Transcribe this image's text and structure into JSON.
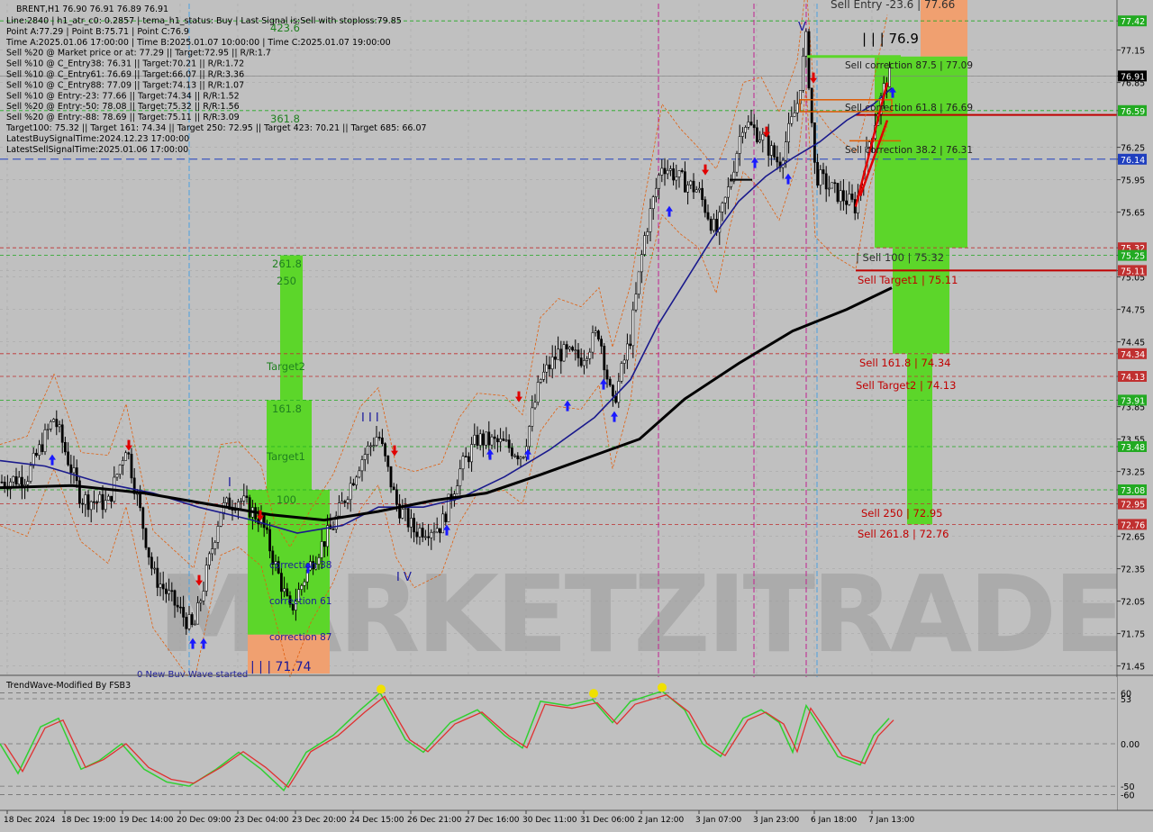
{
  "header": {
    "symbol_line": "BRENT,H1  76.90 76.91 76.89 76.91",
    "info_lines": [
      "Line:2840  |  h1_atr_c0: 0.2857  |  tema_h1_status: Buy  |  Last Signal is:Sell with stoploss:79.85",
      "Point A:77.29 | Point B:75.71 | Point C:76.9",
      "Time A:2025.01.06 17:00:00 | Time B:2025.01.07 10:00:00 | Time C:2025.01.07 19:00:00",
      "Sell %20 @ Market price or at: 77.29 || Target:72.95 || R/R:1.7",
      "Sell %10 @ C_Entry38: 76.31 || Target:70.21 || R/R:1.72",
      "Sell %10 @ C_Entry61: 76.69 || Target:66.07 || R/R:3.36",
      "Sell %10 @ C_Entry88: 77.09 || Target:74.13 || R/R:1.07",
      "Sell %10 @ Entry:-23: 77.66 || Target:74.34 || R/R:1.52",
      "Sell %20 @ Entry:-50: 78.08 || Target:75.32 || R/R:1.56",
      "Sell %20 @ Entry:-88: 78.69 || Target:75.11 || R/R:3.09",
      "Target100: 75.32 || Target 161: 74.34 || Target 250: 72.95 || Target 423: 70.21 || Target 685: 66.07",
      "LatestBuySignalTime:2024.12.23 17:00:00",
      "LatestSellSignalTime:2025.01.06 17:00:00"
    ]
  },
  "indicator": {
    "title": "TrendWave-Modified By FSB3",
    "levels": [
      "60",
      "53",
      "0.00",
      "-50",
      "-60"
    ]
  },
  "chart_data": {
    "type": "candlestick",
    "y_axis_labels": [
      "77.42",
      "77.15",
      "76.91",
      "76.85",
      "76.59",
      "76.25",
      "76.14",
      "75.95",
      "75.65",
      "75.32",
      "75.25",
      "75.11",
      "75.05",
      "74.75",
      "74.45",
      "74.34",
      "74.13",
      "73.91",
      "73.85",
      "73.55",
      "73.48",
      "73.25",
      "73.08",
      "72.95",
      "72.76",
      "72.65",
      "72.35",
      "72.05",
      "71.75",
      "71.45"
    ],
    "ylim": [
      71.38,
      77.58
    ],
    "x_labels": [
      "18 Dec 2024",
      "18 Dec 19:00",
      "19 Dec 14:00",
      "20 Dec 09:00",
      "23 Dec 04:00",
      "23 Dec 20:00",
      "24 Dec 15:00",
      "26 Dec 21:00",
      "27 Dec 16:00",
      "30 Dec 11:00",
      "31 Dec 06:00",
      "2 Jan 12:00",
      "3 Jan 07:00",
      "3 Jan 23:00",
      "6 Jan 18:00",
      "7 Jan 13:00"
    ],
    "current_price": "76.91",
    "price_tags": [
      {
        "value": "77.42",
        "color": "#22aa22"
      },
      {
        "value": "76.91",
        "color": "#000000"
      },
      {
        "value": "76.59",
        "color": "#22aa22"
      },
      {
        "value": "76.14",
        "color": "#1f3fbf"
      },
      {
        "value": "75.32",
        "color": "#c03030"
      },
      {
        "value": "75.25",
        "color": "#22aa22"
      },
      {
        "value": "75.11",
        "color": "#c03030"
      },
      {
        "value": "74.34",
        "color": "#c03030"
      },
      {
        "value": "74.13",
        "color": "#c03030"
      },
      {
        "value": "73.91",
        "color": "#22aa22"
      },
      {
        "value": "73.48",
        "color": "#22aa22"
      },
      {
        "value": "73.08",
        "color": "#22aa22"
      },
      {
        "value": "72.95",
        "color": "#c03030"
      },
      {
        "value": "72.76",
        "color": "#c03030"
      }
    ],
    "annotations": {
      "sell_entry": "Sell Entry -23.6 | 77.66",
      "point_c": "| | | 76.9",
      "correction_875": "Sell correction 87.5 | 77.09",
      "correction_618": "Sell correction 61.8 | 76.69",
      "correction_382": "Sell correction 38.2 | 76.31",
      "sell_100": "| Sell 100 | 75.32",
      "sell_target1": "Sell Target1 | 75.11",
      "sell_1618": "Sell 161.8 | 74.34",
      "sell_target2": "Sell Target2 | 74.13",
      "sell_250": "Sell  250 | 72.95",
      "sell_2618": "Sell  261.8 | 72.76",
      "buy_4236": "423.6",
      "buy_3618": "361.8",
      "buy_2618": "261.8",
      "buy_250": "250",
      "buy_target2": "Target2",
      "buy_1618": "161.8",
      "buy_target1": "Target1",
      "buy_100": "100",
      "buy_corr38": "correction 38",
      "buy_corr61": "correction 61",
      "buy_corr87": "correction 87",
      "buy_point": "| | | 71.74",
      "no_new_buy": "0 New Buy Wave started",
      "wave_v": "V",
      "wave_iii": "I I I",
      "wave_i": "I",
      "wave_iv": "I V"
    },
    "watermark": "MARKETZITRADE",
    "colors": {
      "background": "#c0c0c0",
      "bull": "#000000",
      "bear": "#000000",
      "ma_fast": "#1a1a8c",
      "ma_slow": "#000000",
      "green_zone": "#5cd62a",
      "orange_zone": "#f0a070",
      "sell_line": "#e00000",
      "grid": "#a8a8a8"
    }
  }
}
